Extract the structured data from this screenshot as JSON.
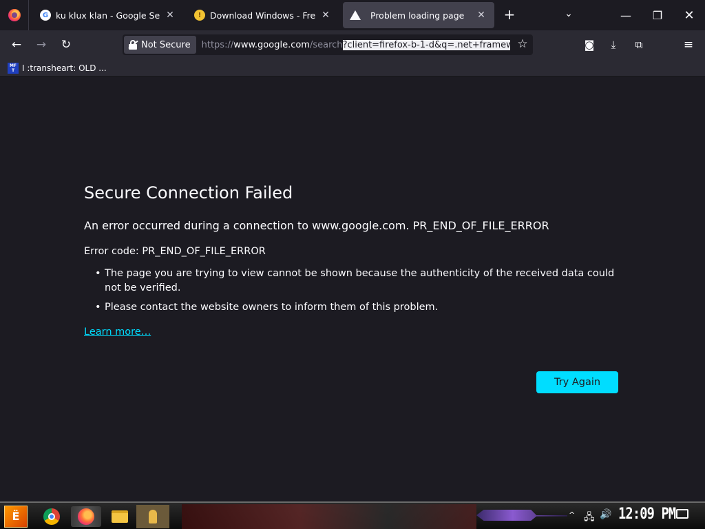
{
  "browser": {
    "tabs": [
      {
        "title": "ku klux klan - Google Search",
        "icon": "google-icon",
        "active": false
      },
      {
        "title": "Download Windows - Free Res",
        "icon": "site-favicon",
        "active": false
      },
      {
        "title": "Problem loading page",
        "icon": "warning-icon",
        "active": true
      }
    ],
    "new_tab_glyph": "+",
    "tab_list_glyph": "⌄",
    "window_controls": {
      "minimize": "—",
      "restore": "❐",
      "close": "✕"
    }
  },
  "navbar": {
    "back_glyph": "←",
    "forward_glyph": "→",
    "reload_glyph": "↻",
    "security_label": "Not Secure",
    "url_scheme": "https://",
    "url_host": "www.google.com",
    "url_path": "/search",
    "url_selected": "?client=firefox-b-1-d&q=.net+framew",
    "star_glyph": "☆",
    "pocket_glyph": "◙",
    "download_glyph": "⤓",
    "extensions_glyph": "⧉",
    "menu_glyph": "≡"
  },
  "bookmarks": [
    {
      "label": "I :transheart: OLD ...",
      "favicon_text": "MF T"
    }
  ],
  "error": {
    "title": "Secure Connection Failed",
    "description": "An error occurred during a connection to www.google.com. PR_END_OF_FILE_ERROR",
    "code_line": "Error code: PR_END_OF_FILE_ERROR",
    "bullets": [
      "The page you are trying to view cannot be shown because the authenticity of the received data could not be verified.",
      "Please contact the website owners to inform them of this problem."
    ],
    "learn_more": "Learn more…",
    "try_again": "Try Again"
  },
  "taskbar": {
    "start_glyph": "Ё",
    "pinned": [
      "chrome-icon",
      "firefox-icon",
      "folder-icon",
      "app-icon"
    ],
    "tray_chevron": "^",
    "network_glyph": "🖧",
    "volume_glyph": "🔊",
    "clock": "12:09 PM"
  },
  "colors": {
    "accent": "#00ddff",
    "page_bg": "#1c1b22",
    "toolbar_bg": "#2b2a33",
    "active_tab_bg": "#42414d"
  }
}
